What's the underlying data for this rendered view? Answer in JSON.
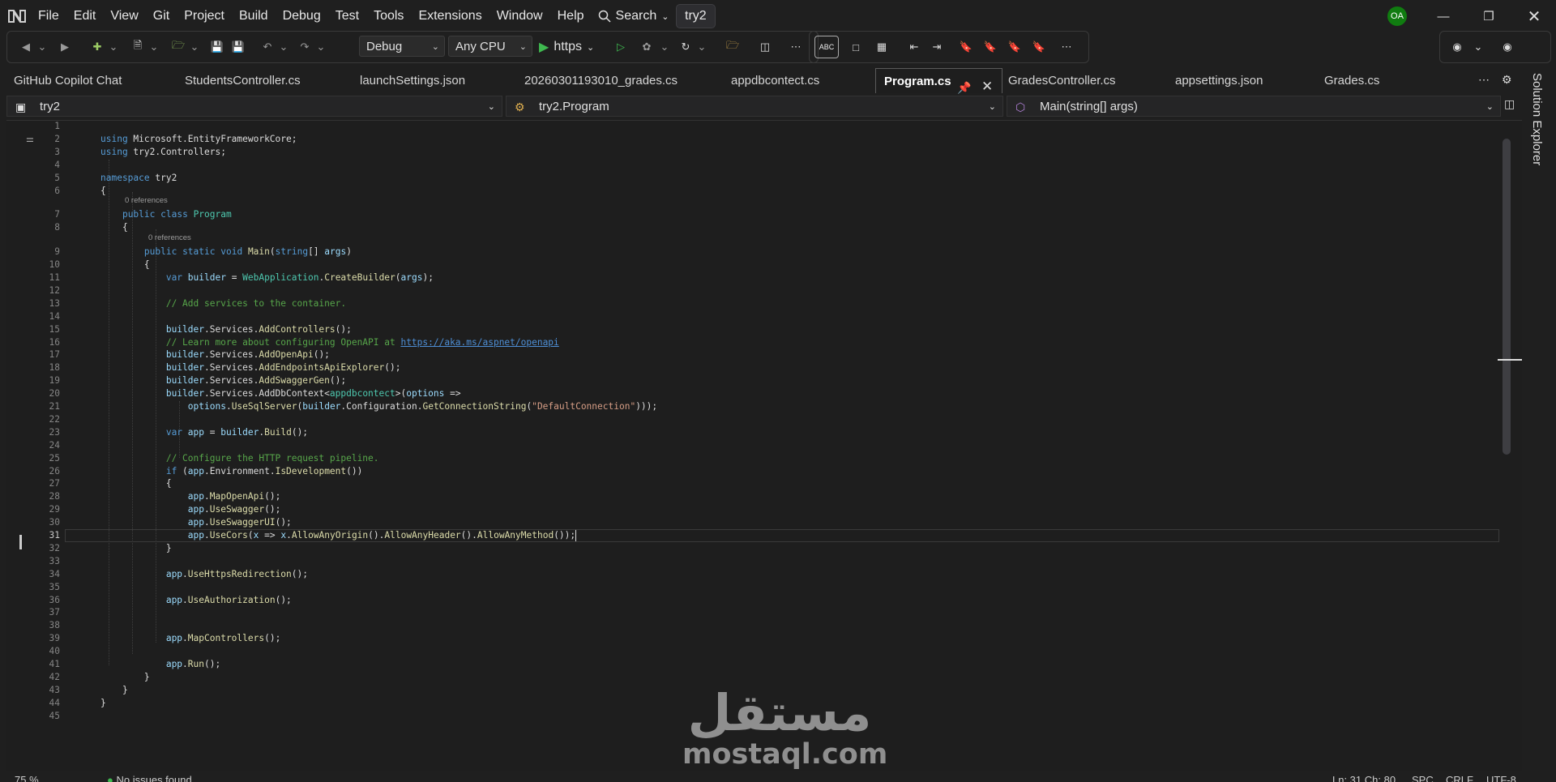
{
  "titlebar": {
    "menu": [
      "File",
      "Edit",
      "View",
      "Git",
      "Project",
      "Build",
      "Debug",
      "Test",
      "Tools",
      "Extensions",
      "Window",
      "Help"
    ],
    "search_label": "Search",
    "solution_name": "try2",
    "avatar_initials": "OA"
  },
  "toolbar": {
    "configuration": "Debug",
    "platform": "Any CPU",
    "run_profile": "https",
    "spellcheck_label": "ABC"
  },
  "tabs": [
    {
      "label": "GitHub Copilot Chat",
      "active": false
    },
    {
      "label": "StudentsController.cs",
      "active": false
    },
    {
      "label": "launchSettings.json",
      "active": false
    },
    {
      "label": "20260301193010_grades.cs",
      "active": false
    },
    {
      "label": "appdbcontect.cs",
      "active": false
    },
    {
      "label": "Program.cs",
      "active": true
    },
    {
      "label": "GradesController.cs",
      "active": false
    },
    {
      "label": "appsettings.json",
      "active": false
    },
    {
      "label": "Grades.cs",
      "active": false
    }
  ],
  "navbar": {
    "project": "try2",
    "type": "try2.Program",
    "member": "Main(string[] args)"
  },
  "editor": {
    "current_line": 31,
    "codelens_text": "0 references",
    "lines": [
      "",
      "using Microsoft.EntityFrameworkCore;",
      "using try2.Controllers;",
      "",
      "namespace try2",
      "{",
      "    public class Program",
      "    {",
      "        public static void Main(string[] args)",
      "        {",
      "            var builder = WebApplication.CreateBuilder(args);",
      "",
      "            // Add services to the container.",
      "",
      "            builder.Services.AddControllers();",
      "            // Learn more about configuring OpenAPI at https://aka.ms/aspnet/openapi",
      "            builder.Services.AddOpenApi();",
      "            builder.Services.AddEndpointsApiExplorer();",
      "            builder.Services.AddSwaggerGen();",
      "            builder.Services.AddDbContext<appdbcontect>(options =>",
      "                options.UseSqlServer(builder.Configuration.GetConnectionString(\"DefaultConnection\")));",
      "",
      "            var app = builder.Build();",
      "",
      "            // Configure the HTTP request pipeline.",
      "            if (app.Environment.IsDevelopment())",
      "            {",
      "                app.MapOpenApi();",
      "                app.UseSwagger();",
      "                app.UseSwaggerUI();",
      "                app.UseCors(x => x.AllowAnyOrigin().AllowAnyHeader().AllowAnyMethod());",
      "            }",
      "",
      "            app.UseHttpsRedirection();",
      "",
      "            app.UseAuthorization();",
      "",
      "",
      "            app.MapControllers();",
      "",
      "            app.Run();",
      "        }",
      "    }",
      "}",
      ""
    ]
  },
  "side_panel": {
    "label": "Solution Explorer"
  },
  "statusbar": {
    "zoom": "75 %",
    "issues": "No issues found",
    "position": "Ln: 31  Ch: 80",
    "encoding_1": "SPC",
    "encoding_2": "CRLF",
    "encoding_3": "UTF-8"
  },
  "watermark": {
    "arabic": "مستقل",
    "latin": "mostaql.com"
  },
  "colors": {
    "accent": "#569cd6",
    "type": "#4ec9b0",
    "method": "#dcdcaa",
    "comment": "#57a64a",
    "string": "#d69d85",
    "run_green": "#3fb950"
  }
}
